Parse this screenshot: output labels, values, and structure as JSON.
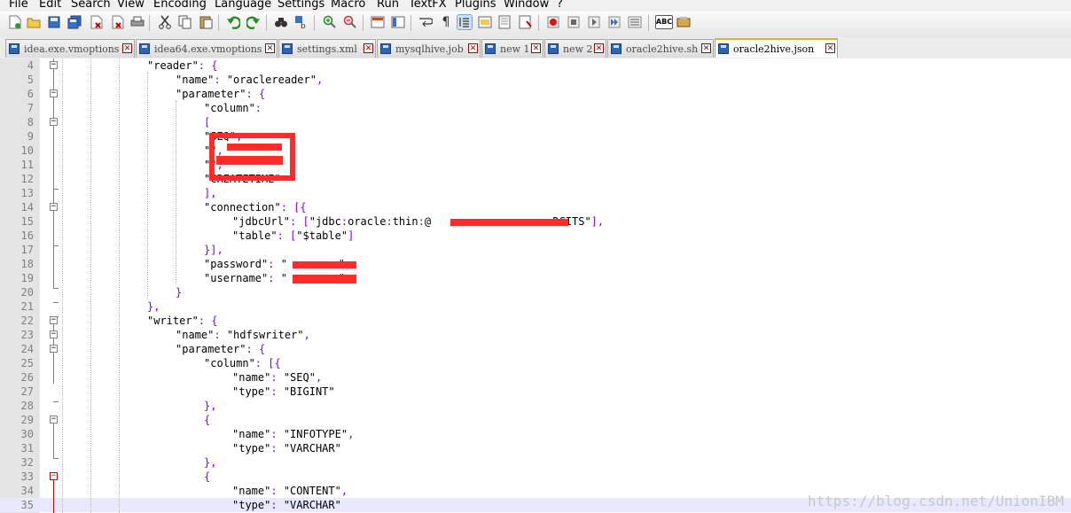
{
  "menu": [
    "File",
    "Edit",
    "Search",
    "View",
    "Encoding",
    "Language",
    "Settings",
    "Macro",
    "Run",
    "TextFX",
    "Plugins",
    "Window",
    "?"
  ],
  "toolbar": {
    "icons": [
      "new-file-icon",
      "open-file-icon",
      "save-icon",
      "save-all-icon",
      "close-icon",
      "close-all-icon",
      "print-icon",
      "cut-icon",
      "copy-icon",
      "paste-icon",
      "undo-icon",
      "redo-icon",
      "find-icon",
      "replace-icon",
      "zoom-in-icon",
      "zoom-out-icon",
      "sync-vertical-icon",
      "sync-horizontal-icon",
      "word-wrap-icon",
      "show-all-chars-icon",
      "indent-guide-icon",
      "document-map-icon",
      "function-list-icon",
      "folder-as-workspace-icon",
      "record-macro-icon",
      "stop-macro-icon",
      "play-macro-icon",
      "run-macro-multiple-icon",
      "save-macro-icon",
      "spellcheck-icon",
      "plugin-icon"
    ]
  },
  "tabs": [
    {
      "name": "idea.exe.vmoptions",
      "active": false
    },
    {
      "name": "idea64.exe.vmoptions",
      "active": false
    },
    {
      "name": "settings.xml",
      "active": false
    },
    {
      "name": "mysqlhive.job",
      "active": false
    },
    {
      "name": "new 1",
      "active": false
    },
    {
      "name": "new 2",
      "active": false
    },
    {
      "name": "oracle2hive.sh",
      "active": false
    },
    {
      "name": "oracle2hive.json",
      "active": true
    }
  ],
  "editor": {
    "lines": [
      {
        "n": "4",
        "indent": 3,
        "text": "\"reader\": {"
      },
      {
        "n": "5",
        "indent": 4,
        "text": "\"name\": \"oraclereader\","
      },
      {
        "n": "6",
        "indent": 4,
        "text": "\"parameter\": {"
      },
      {
        "n": "7",
        "indent": 5,
        "text": "\"column\":"
      },
      {
        "n": "8",
        "indent": 5,
        "text": "["
      },
      {
        "n": "9",
        "indent": 5,
        "text": "\"SEQ\","
      },
      {
        "n": "10",
        "indent": 5,
        "text": "\"\","
      },
      {
        "n": "11",
        "indent": 5,
        "text": "\"\","
      },
      {
        "n": "12",
        "indent": 5,
        "text": "\"CREATETIME\""
      },
      {
        "n": "13",
        "indent": 5,
        "text": "],"
      },
      {
        "n": "14",
        "indent": 5,
        "text": "\"connection\": [{"
      },
      {
        "n": "15",
        "indent": 6,
        "text": "\"jdbcUrl\": [\"jdbc:oracle:thin:@                   DCITS\"],"
      },
      {
        "n": "16",
        "indent": 6,
        "text": "\"table\": [\"$table\"]"
      },
      {
        "n": "17",
        "indent": 5,
        "text": "}],"
      },
      {
        "n": "18",
        "indent": 5,
        "text": "\"password\": \"        \","
      },
      {
        "n": "19",
        "indent": 5,
        "text": "\"username\": \"        \""
      },
      {
        "n": "20",
        "indent": 4,
        "text": "}"
      },
      {
        "n": "21",
        "indent": 3,
        "text": "},"
      },
      {
        "n": "22",
        "indent": 3,
        "text": "\"writer\": {"
      },
      {
        "n": "23",
        "indent": 4,
        "text": "\"name\": \"hdfswriter\","
      },
      {
        "n": "24",
        "indent": 4,
        "text": "\"parameter\": {"
      },
      {
        "n": "25",
        "indent": 5,
        "text": "\"column\": [{"
      },
      {
        "n": "26",
        "indent": 6,
        "text": "\"name\": \"SEQ\","
      },
      {
        "n": "27",
        "indent": 6,
        "text": "\"type\": \"BIGINT\""
      },
      {
        "n": "28",
        "indent": 5,
        "text": "},"
      },
      {
        "n": "29",
        "indent": 5,
        "text": "{"
      },
      {
        "n": "30",
        "indent": 6,
        "text": "\"name\": \"INFOTYPE\","
      },
      {
        "n": "31",
        "indent": 6,
        "text": "\"type\": \"VARCHAR\""
      },
      {
        "n": "32",
        "indent": 5,
        "text": "},"
      },
      {
        "n": "33",
        "indent": 5,
        "text": "{"
      },
      {
        "n": "34",
        "indent": 6,
        "text": "\"name\": \"CONTENT\","
      },
      {
        "n": "35",
        "indent": 6,
        "text": "\"type\": \"VARCHAR\""
      }
    ]
  },
  "watermark": "https://blog.csdn.net/UnionIBM"
}
